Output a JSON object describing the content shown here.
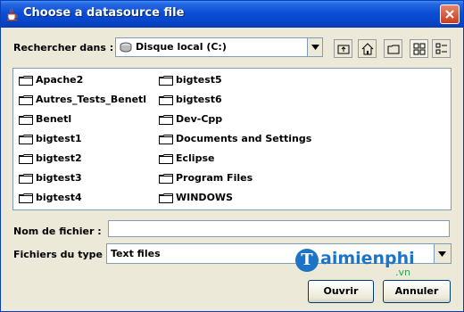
{
  "window": {
    "title": "Choose a datasource file",
    "title_icon": "java-cup-icon",
    "close_icon": "close-icon"
  },
  "look_in": {
    "label": "Rechercher dans :",
    "selected": "Disque local (C:)",
    "drive_icon": "hard-drive-icon"
  },
  "toolbar": [
    {
      "name": "up-one-level-button",
      "icon": "folder-up-icon"
    },
    {
      "name": "home-button",
      "icon": "home-icon"
    },
    {
      "name": "new-folder-button",
      "icon": "new-folder-icon"
    },
    {
      "name": "list-view-button",
      "icon": "list-view-icon"
    },
    {
      "name": "details-view-button",
      "icon": "details-view-icon"
    }
  ],
  "files": {
    "column1": [
      "Apache2",
      "Autres_Tests_Benetl",
      "Benetl",
      "bigtest1",
      "bigtest2",
      "bigtest3",
      "bigtest4"
    ],
    "column2": [
      "bigtest5",
      "bigtest6",
      "Dev-Cpp",
      "Documents and Settings",
      "Eclipse",
      "Program Files",
      "WINDOWS"
    ]
  },
  "filename": {
    "label": "Nom de fichier :",
    "value": ""
  },
  "filetype": {
    "label": "Fichiers du type :",
    "selected": "Text files"
  },
  "buttons": {
    "open": "Ouvrir",
    "cancel": "Annuler"
  },
  "watermark": {
    "initial": "T",
    "text": "aimienphi",
    "suffix": ".vn"
  }
}
